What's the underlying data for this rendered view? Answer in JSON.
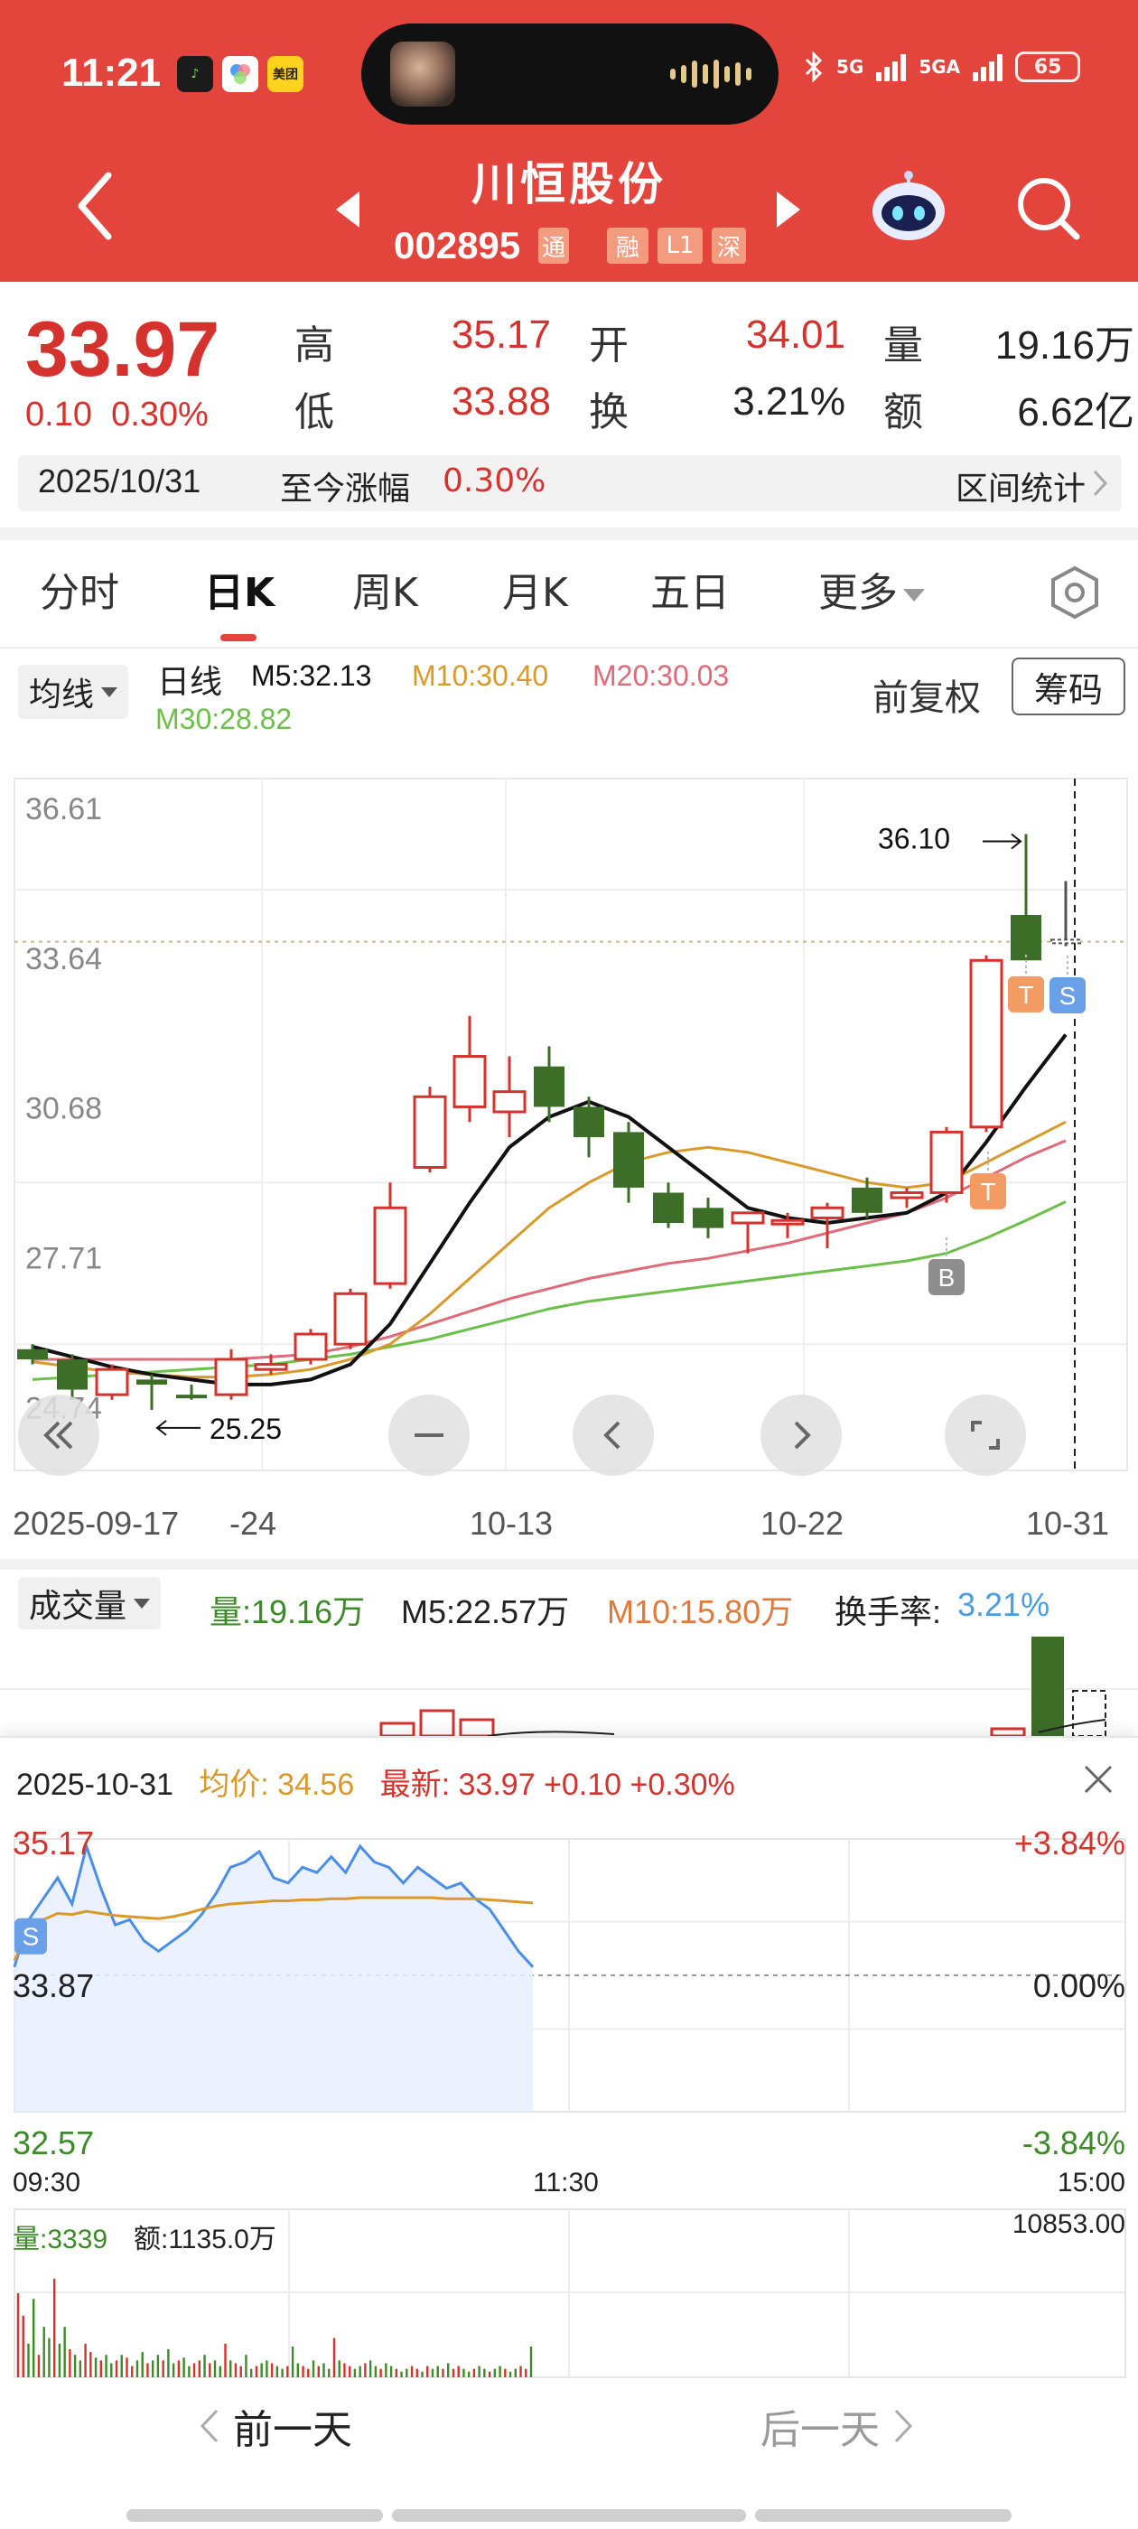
{
  "status_bar": {
    "time": "11:21",
    "app_badges": [
      "music-app-icon",
      "photos-app-icon",
      "meituan-app-icon"
    ],
    "meituan_label": "美团",
    "network1": "5G",
    "network2": "5GA",
    "battery": "65"
  },
  "header": {
    "title": "川恒股份",
    "code": "002895",
    "tags": [
      "通",
      "融",
      "L1",
      "深"
    ]
  },
  "quote": {
    "price": "33.97",
    "change": "0.10",
    "change_pct": "0.30%",
    "high_label": "高",
    "high": "35.17",
    "low_label": "低",
    "low": "33.88",
    "open_label": "开",
    "open": "34.01",
    "turnover_label": "换",
    "turnover": "3.21%",
    "volume_label": "量",
    "volume": "19.16万",
    "amount_label": "额",
    "amount": "6.62亿"
  },
  "range": {
    "date": "2025/10/31",
    "label": "至今涨幅",
    "value": "0.30%",
    "stat_button": "区间统计"
  },
  "tabs": [
    {
      "label": "分时",
      "active": false
    },
    {
      "label": "日K",
      "active": true
    },
    {
      "label": "周K",
      "active": false
    },
    {
      "label": "月K",
      "active": false
    },
    {
      "label": "五日",
      "active": false
    },
    {
      "label": "更多",
      "active": false
    }
  ],
  "ma_row": {
    "select_label": "均线",
    "period": "日线",
    "m5": "M5:32.13",
    "m10": "M10:30.40",
    "m20": "M20:30.03",
    "m30": "M30:28.82",
    "adjust": "前复权",
    "chips": "筹码"
  },
  "colors": {
    "up": "#d6322d",
    "down": "#3c6e28",
    "m5": "#111111",
    "m10": "#d99a2b",
    "m20": "#e06a78",
    "m30": "#6cc04a",
    "header": "#e3453d"
  },
  "chart_data": [
    {
      "type": "candlestick",
      "price_ticks": [
        "36.61",
        "33.64",
        "30.68",
        "27.71",
        "24.74"
      ],
      "date_labels": [
        "2025-09-17",
        "-24",
        "10-13",
        "10-22",
        "10-31"
      ],
      "ylim": [
        24.74,
        36.61
      ],
      "max_label": "36.10",
      "min_label": "25.25",
      "current_price_line": 33.97,
      "markers": [
        {
          "label": "B",
          "index": 23
        },
        {
          "label": "T",
          "index": 25
        },
        {
          "label": "S",
          "index": 26
        },
        {
          "label": "T",
          "index": 24
        }
      ],
      "candles": [
        {
          "o": 25.9,
          "h": 26.0,
          "l": 25.6,
          "c": 25.7
        },
        {
          "o": 25.7,
          "h": 25.8,
          "l": 24.9,
          "c": 25.1
        },
        {
          "o": 25.0,
          "h": 25.6,
          "l": 24.9,
          "c": 25.5
        },
        {
          "o": 25.3,
          "h": 25.4,
          "l": 24.7,
          "c": 25.2
        },
        {
          "o": 25.0,
          "h": 25.2,
          "l": 24.9,
          "c": 24.95
        },
        {
          "o": 25.0,
          "h": 25.9,
          "l": 24.9,
          "c": 25.7
        },
        {
          "o": 25.5,
          "h": 25.8,
          "l": 25.4,
          "c": 25.6
        },
        {
          "o": 25.7,
          "h": 26.3,
          "l": 25.6,
          "c": 26.2
        },
        {
          "o": 26.0,
          "h": 27.1,
          "l": 25.9,
          "c": 27.0
        },
        {
          "o": 27.2,
          "h": 29.2,
          "l": 27.1,
          "c": 28.7
        },
        {
          "o": 29.5,
          "h": 31.1,
          "l": 29.4,
          "c": 30.9
        },
        {
          "o": 30.7,
          "h": 32.5,
          "l": 30.4,
          "c": 31.7
        },
        {
          "o": 30.6,
          "h": 31.7,
          "l": 30.1,
          "c": 31.0
        },
        {
          "o": 31.5,
          "h": 31.9,
          "l": 30.4,
          "c": 30.7
        },
        {
          "o": 30.7,
          "h": 30.9,
          "l": 29.7,
          "c": 30.1
        },
        {
          "o": 30.2,
          "h": 30.4,
          "l": 28.8,
          "c": 29.1
        },
        {
          "o": 29.0,
          "h": 29.2,
          "l": 28.3,
          "c": 28.4
        },
        {
          "o": 28.7,
          "h": 28.9,
          "l": 28.1,
          "c": 28.3
        },
        {
          "o": 28.4,
          "h": 28.6,
          "l": 27.8,
          "c": 28.6
        },
        {
          "o": 28.4,
          "h": 28.6,
          "l": 28.1,
          "c": 28.45
        },
        {
          "o": 28.5,
          "h": 28.8,
          "l": 27.9,
          "c": 28.7
        },
        {
          "o": 29.1,
          "h": 29.3,
          "l": 28.5,
          "c": 28.6
        },
        {
          "o": 28.9,
          "h": 29.1,
          "l": 28.7,
          "c": 29.0
        },
        {
          "o": 29.0,
          "h": 30.3,
          "l": 28.8,
          "c": 30.2
        },
        {
          "o": 30.3,
          "h": 33.7,
          "l": 30.2,
          "c": 33.6
        },
        {
          "o": 34.5,
          "h": 36.1,
          "l": 33.6,
          "c": 33.6
        },
        {
          "o": 34.01,
          "h": 35.17,
          "l": 33.88,
          "c": 33.97
        }
      ],
      "ma5": [
        25.95,
        25.75,
        25.55,
        25.4,
        25.3,
        25.2,
        25.2,
        25.3,
        25.6,
        26.4,
        27.6,
        28.8,
        29.9,
        30.5,
        30.8,
        30.5,
        29.9,
        29.3,
        28.7,
        28.5,
        28.4,
        28.5,
        28.6,
        29.0,
        30.0,
        31.1,
        32.13
      ],
      "ma10": [
        25.65,
        25.55,
        25.45,
        25.4,
        25.35,
        25.35,
        25.4,
        25.5,
        25.7,
        26.0,
        26.6,
        27.3,
        28.0,
        28.7,
        29.2,
        29.6,
        29.8,
        29.9,
        29.8,
        29.6,
        29.4,
        29.2,
        29.1,
        29.2,
        29.6,
        30.0,
        30.4
      ],
      "ma20": [
        25.7,
        25.7,
        25.7,
        25.7,
        25.7,
        25.7,
        25.75,
        25.8,
        25.95,
        26.15,
        26.4,
        26.65,
        26.9,
        27.1,
        27.3,
        27.45,
        27.6,
        27.7,
        27.85,
        28.0,
        28.2,
        28.4,
        28.6,
        28.9,
        29.3,
        29.7,
        30.03
      ],
      "ma30": [
        25.3,
        25.35,
        25.4,
        25.45,
        25.5,
        25.55,
        25.6,
        25.7,
        25.8,
        25.95,
        26.1,
        26.3,
        26.5,
        26.7,
        26.85,
        26.95,
        27.05,
        27.15,
        27.25,
        27.35,
        27.45,
        27.55,
        27.65,
        27.8,
        28.1,
        28.45,
        28.82
      ]
    },
    {
      "type": "line",
      "date": "2025-10-31",
      "avg_label": "均价:",
      "avg_value": "34.56",
      "latest_label": "最新:",
      "latest_value": "33.97 +0.10 +0.30%",
      "y_left_ticks": [
        "35.17",
        "33.87",
        "32.57"
      ],
      "y_right_ticks": [
        "+3.84%",
        "0.00%",
        "-3.84%"
      ],
      "x_ticks": [
        "09:30",
        "11:30",
        "15:00"
      ],
      "ylim": [
        32.57,
        35.17
      ],
      "price": [
        33.95,
        34.4,
        34.6,
        34.8,
        34.55,
        35.1,
        34.7,
        34.35,
        34.4,
        34.2,
        34.1,
        34.2,
        34.3,
        34.45,
        34.65,
        34.9,
        34.95,
        35.05,
        34.8,
        34.75,
        34.9,
        34.85,
        35.0,
        34.85,
        35.1,
        34.95,
        34.9,
        34.75,
        34.9,
        34.8,
        34.7,
        34.75,
        34.6,
        34.5,
        34.3,
        34.1,
        33.95
      ],
      "avg": [
        34.01,
        34.3,
        34.4,
        34.46,
        34.45,
        34.48,
        34.46,
        34.44,
        34.43,
        34.42,
        34.41,
        34.43,
        34.46,
        34.5,
        34.53,
        34.55,
        34.56,
        34.57,
        34.58,
        34.58,
        34.59,
        34.59,
        34.6,
        34.6,
        34.61,
        34.61,
        34.61,
        34.61,
        34.61,
        34.61,
        34.6,
        34.6,
        34.6,
        34.59,
        34.58,
        34.57,
        34.56
      ],
      "marker": "S"
    }
  ],
  "volume": {
    "select_label": "成交量",
    "vol": "量:19.16万",
    "m5": "M5:22.57万",
    "m10": "M10:15.80万",
    "turnover_label": "换手率:",
    "turnover_value": "3.21%"
  },
  "intraday_volume": {
    "vol": "量:3339",
    "amount": "额:1135.0万",
    "max": "10853.00"
  },
  "nav": {
    "prev": "前一天",
    "next": "后一天"
  }
}
